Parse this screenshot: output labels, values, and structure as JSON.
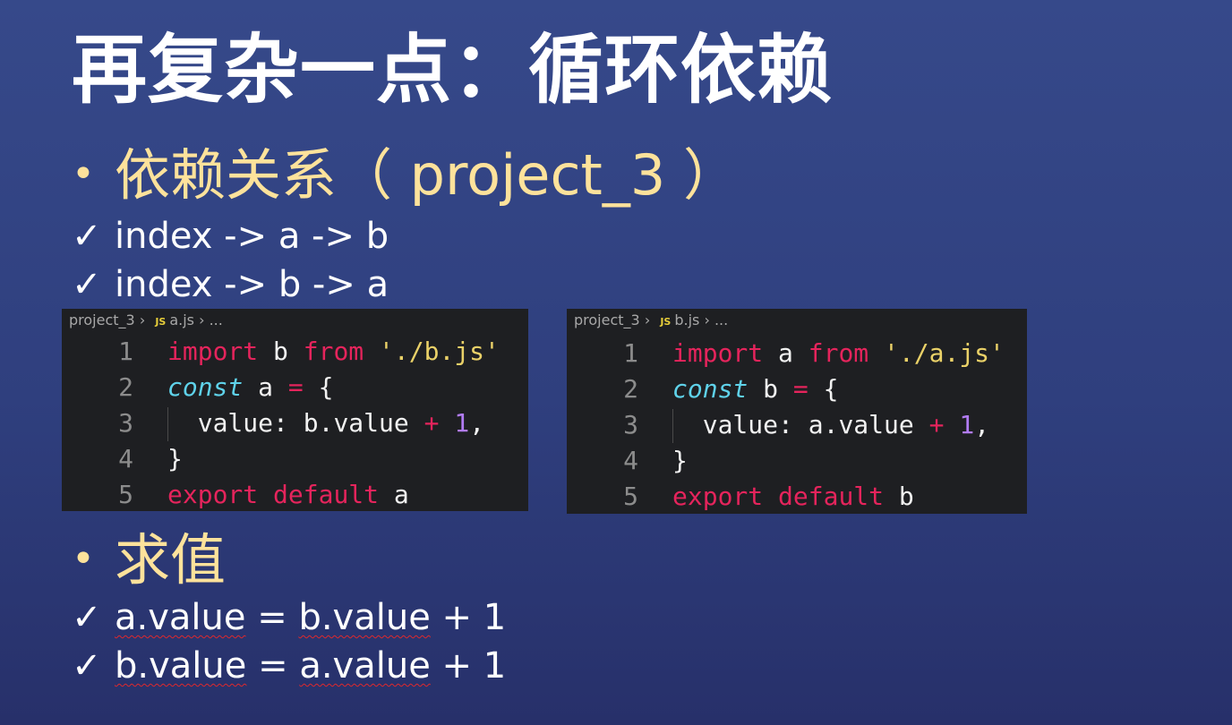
{
  "title": "再复杂一点：循环依赖",
  "section1": {
    "bullet": "•",
    "heading": "依赖关系（ project_3 ）",
    "checks": [
      "index -> a -> b",
      "index -> b -> a"
    ]
  },
  "check_mark": "✓",
  "code_a": {
    "breadcrumb": {
      "project": "project_3",
      "sep": "›",
      "js_badge": "JS",
      "file": "a.js",
      "more": "..."
    },
    "line_numbers": [
      "1",
      "2",
      "3",
      "4",
      "5"
    ],
    "tokens": {
      "import": "import",
      "var_b": "b",
      "from": "from",
      "path": "'./b.js'",
      "const": "const",
      "var_a": "a",
      "eq": "=",
      "lbrace": "{",
      "value_key": "value:",
      "ref": "b.value",
      "plus": "+",
      "one": "1",
      "comma": ",",
      "rbrace": "}",
      "export": "export",
      "default": "default",
      "export_var": "a"
    }
  },
  "code_b": {
    "breadcrumb": {
      "project": "project_3",
      "sep": "›",
      "js_badge": "JS",
      "file": "b.js",
      "more": "..."
    },
    "line_numbers": [
      "1",
      "2",
      "3",
      "4",
      "5"
    ],
    "tokens": {
      "import": "import",
      "var_a": "a",
      "from": "from",
      "path": "'./a.js'",
      "const": "const",
      "var_b": "b",
      "eq": "=",
      "lbrace": "{",
      "value_key": "value:",
      "ref": "a.value",
      "plus": "+",
      "one": "1",
      "comma": ",",
      "rbrace": "}",
      "export": "export",
      "default": "default",
      "export_var": "b"
    }
  },
  "section2": {
    "bullet": "•",
    "heading": "求值",
    "eq1": {
      "lhs": "a.value",
      "mid": " = ",
      "rhs": "b.value",
      "tail": " + 1"
    },
    "eq2": {
      "lhs": "b.value",
      "mid": " = ",
      "rhs": "a.value",
      "tail": " + 1"
    }
  }
}
